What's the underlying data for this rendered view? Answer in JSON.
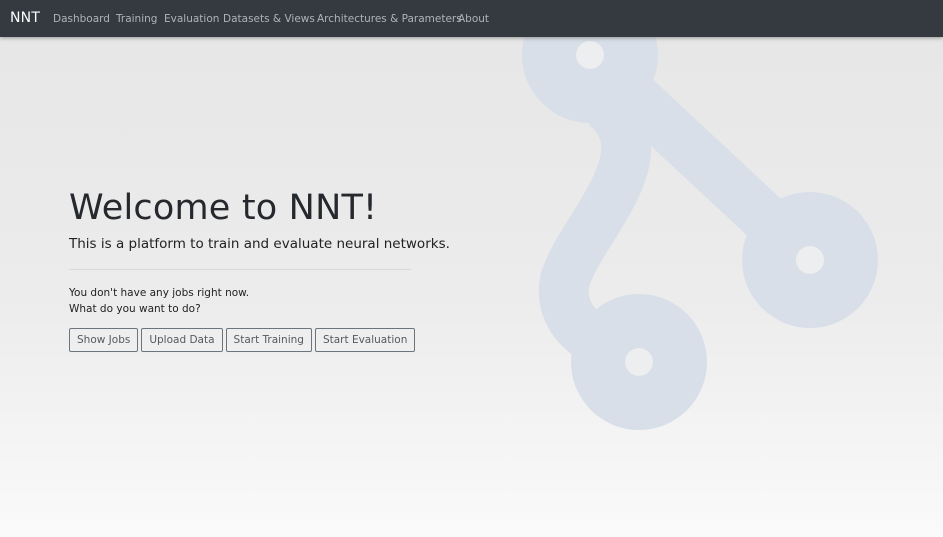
{
  "navbar": {
    "brand": "NNT",
    "items": [
      {
        "label": "Dashboard"
      },
      {
        "label": "Training"
      },
      {
        "label": "Evaluation"
      },
      {
        "label": "Datasets & Views"
      },
      {
        "label": "Architectures & Parameters"
      },
      {
        "label": "About"
      }
    ]
  },
  "hero": {
    "title": "Welcome to NNT!",
    "lead": "This is a platform to train and evaluate neural networks."
  },
  "jobs": {
    "empty_message": "You don't have any jobs right now.",
    "prompt": "What do you want to do?",
    "buttons": [
      {
        "label": "Show Jobs"
      },
      {
        "label": "Upload Data"
      },
      {
        "label": "Start Training"
      },
      {
        "label": "Start Evaluation"
      }
    ]
  },
  "colors": {
    "navbar_bg": "#343a40",
    "nav_link": "#aeb3b8",
    "brand": "#ffffff",
    "logo_watermark": "#d9dfe8"
  },
  "icons": {
    "watermark": "network-graph-logo-icon"
  }
}
